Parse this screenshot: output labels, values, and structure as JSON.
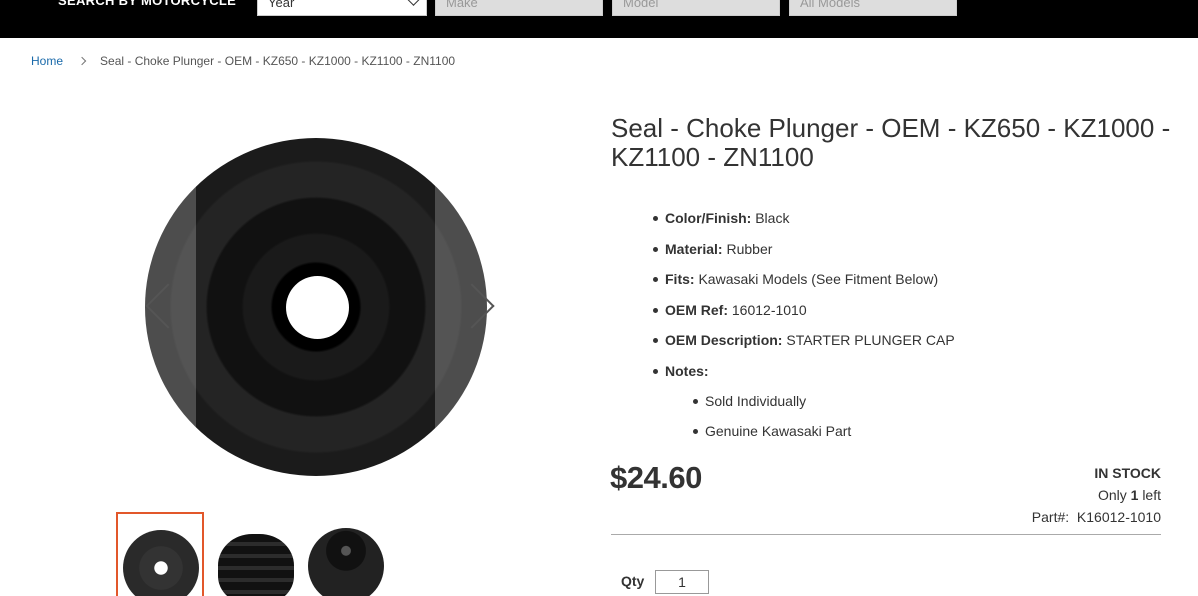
{
  "topbar": {
    "label": "SEARCH BY MOTORCYCLE",
    "year": "Year",
    "make": "Make",
    "model": "Model",
    "all_models": "All Models"
  },
  "breadcrumb": {
    "home": "Home",
    "current": "Seal - Choke Plunger - OEM - KZ650 - KZ1000 - KZ1100 - ZN1100"
  },
  "product": {
    "title": "Seal - Choke Plunger - OEM - KZ650 - KZ1000 - KZ1100 - ZN1100",
    "specs": [
      {
        "label": "Color/Finish:",
        "value": "Black"
      },
      {
        "label": "Material:",
        "value": "Rubber"
      },
      {
        "label": "Fits:",
        "value": "Kawasaki Models (See Fitment Below)"
      },
      {
        "label": "OEM Ref:",
        "value": "16012-1010"
      },
      {
        "label": "OEM Description:",
        "value": "STARTER PLUNGER CAP"
      },
      {
        "label": "Notes:",
        "value": ""
      }
    ],
    "notes": [
      "Sold Individually",
      "Genuine Kawasaki Part"
    ],
    "price": "$24.60",
    "stock_status": "IN STOCK",
    "stock_only": "Only",
    "stock_count": "1",
    "stock_left": "left",
    "part_label": "Part#:",
    "part_number": "K16012-1010",
    "qty_label": "Qty",
    "qty_value": "1"
  },
  "colors": {
    "accent": "#e2572a",
    "link": "#1a6aaa",
    "topbar": "#000000"
  }
}
